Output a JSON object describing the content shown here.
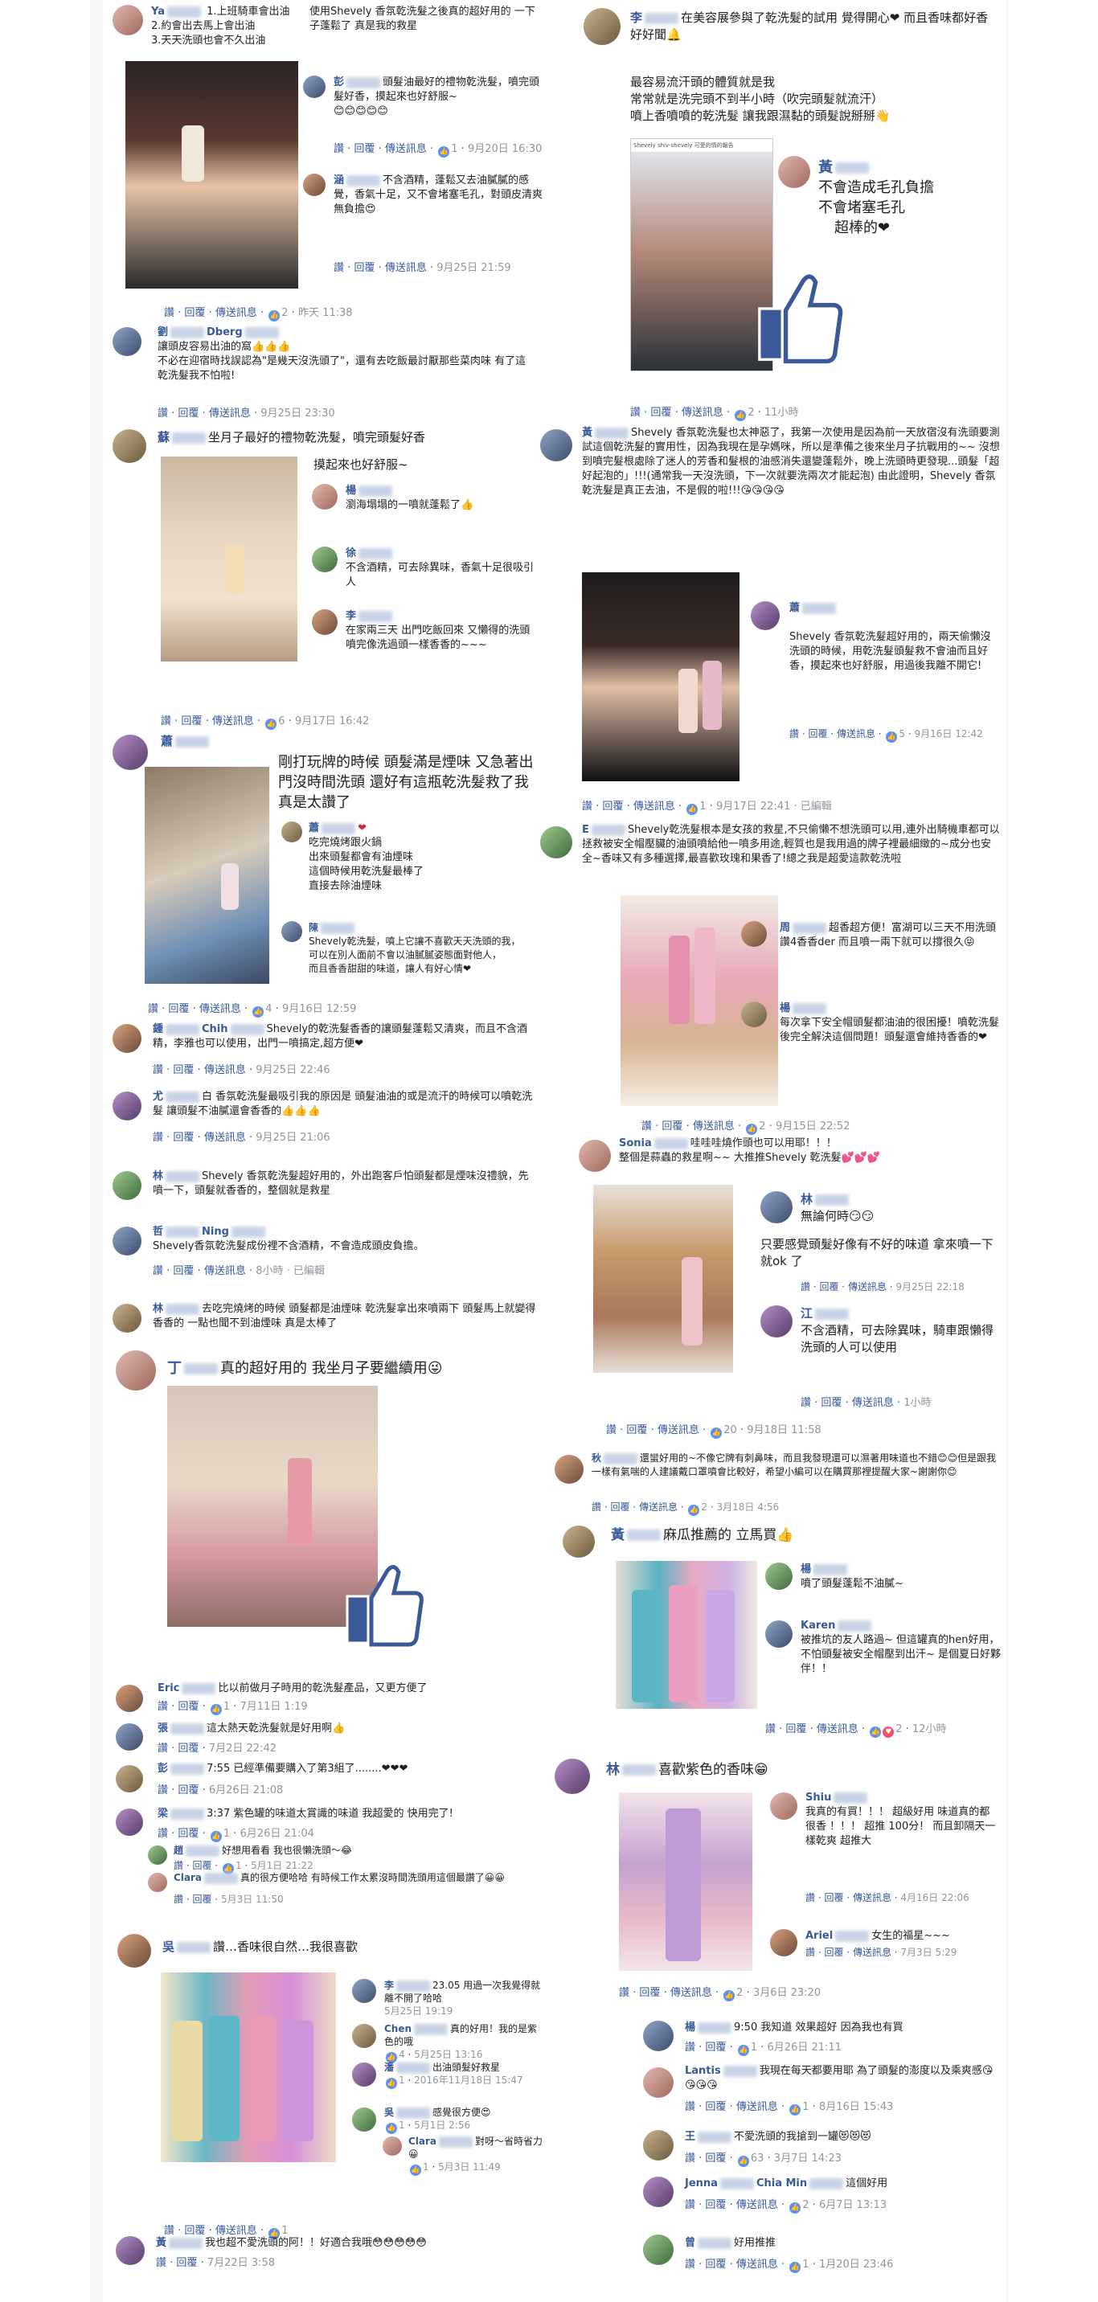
{
  "colors": {
    "link": "#385898",
    "muted": "#90949c",
    "background": "#f5f6f7",
    "like_blue": "#5890ff",
    "heart_red": "#e02434"
  },
  "actions": {
    "like": "讚",
    "reply": "回覆",
    "message": "傳送訊息"
  },
  "left": {
    "c1": {
      "name": "Ya",
      "lines": [
        "1.上班騎車會出油",
        "2.約會出去馬上會出油",
        "3.天天洗頭也會不久出油"
      ],
      "side": "使用Shevely 香氛乾洗髮之後真的超好用的 一下子蓬鬆了 真是我的救星",
      "reactions": "2",
      "time": "昨天 11:38",
      "r1": {
        "name": "彭",
        "text": "頭髮油最好的禮物乾洗髮，噴完頭髮好香，摸起來也好舒服~",
        "emoji": "😊😊😊😊😊",
        "reactions": "1",
        "time": "9月20日 16:30"
      },
      "r2": {
        "name": "涵",
        "text": "不含酒精，蓬鬆又去油膩膩的感覺，香氣十足，又不會堵塞毛孔，對頭皮清爽無負擔😍",
        "time": "9月25日 21:59"
      }
    },
    "c2": {
      "name": "劉",
      "name2": "Dberg",
      "text": "讓頭皮容易出油的窩👍👍👍",
      "text2": "不必在迎宿時找誤認為\"是幾天沒洗頭了\"，還有去吃飯最討厭那些菜肉味 有了這乾洗髮我不怕啦!",
      "time": "9月25日 23:30"
    },
    "c3": {
      "name": "蘇",
      "text": "坐月子最好的禮物乾洗髮，噴完頭髮好香",
      "text2": "摸起來也好舒服~",
      "reactions": "6",
      "time": "9月17日 16:42",
      "r1": {
        "name": "楊",
        "text": "瀏海塌塌的一噴就蓬鬆了👍"
      },
      "r2": {
        "name": "徐",
        "text": "不含酒精，可去除異味，香氣十足很吸引人"
      },
      "r3": {
        "name": "李",
        "text": "在家兩三天 出門吃飯回來 又懶得的洗頭 噴完像洗過頭一樣香香的~~~"
      }
    },
    "c4": {
      "name": "蕭",
      "text": "剛打玩牌的時候 頭髮滿是煙味 又急著出門沒時間洗頭 還好有這瓶乾洗髮救了我 真是太讚了",
      "reactions": "4",
      "time": "9月16日 12:59",
      "r1": {
        "name": "蕭",
        "lines": [
          "吃完燒烤跟火鍋",
          "出來頭髮都會有油煙味",
          "這個時候用乾洗髮最棒了",
          "直接去除油煙味"
        ]
      },
      "r2": {
        "name": "陳",
        "lines": [
          "Shevely乾洗髮，噴上它讓不喜歡天天洗頭的我，",
          "可以在別人面前不會以油膩膩姿態面對他人，",
          "而且香香甜甜的味道，讓人有好心情❤"
        ]
      }
    },
    "c5": {
      "name": "鍾",
      "name2": "Chih",
      "text": "Shevely的乾洗髮香香的讓頭髮蓬鬆又清爽，而且不含酒精，李雅也可以使用，出門一噴搞定,超方便❤",
      "time": "9月25日 22:46"
    },
    "c6": {
      "name": "尤",
      "text": "白 香氛乾洗髮最吸引我的原因是 頭髮油油的或是流汗的時候可以噴乾洗髮 讓頭髮不油膩還會香香的👍👍👍",
      "time": "9月25日 21:06"
    },
    "c7": {
      "name": "林",
      "text": "Shevely 香氛乾洗髮超好用的，外出跑客戶怕頭髮都是煙味沒禮貌，先噴一下，頭髮就香香的，整個就是救星"
    },
    "c8": {
      "name": "哲",
      "name2": "Ning",
      "text": "Shevely香氛乾洗髮成份裡不含酒精，不會造成頭皮負擔。",
      "time": "8小時 · 已編輯"
    },
    "c9": {
      "name": "林",
      "text": "去吃完燒烤的時候 頭髮都是油煙味 乾洗髮拿出來噴兩下 頭髮馬上就變得香香的 一點也聞不到油煙味 真是太棒了"
    },
    "c10": {
      "name": "丁",
      "text": "真的超好用的 我坐月子要繼續用😜",
      "replies": [
        {
          "name": "Eric",
          "text": "比以前做月子時用的乾洗髮產品，又更方便了",
          "reactions": "1",
          "time": "7月11日 1:19"
        },
        {
          "name": "張",
          "text": "這太熱天乾洗髮就是好用啊👍",
          "time": "7月2日 22:42"
        },
        {
          "name": "彭",
          "text": "7:55 已經準備要購入了第3組了........❤❤❤",
          "time": "6月26日 21:08"
        },
        {
          "name": "梁",
          "text": "3:37 紫色罐的味道太賞識的味道 我超愛的 快用完了!",
          "reactions": "1",
          "time": "6月26日 21:04"
        },
        {
          "name": "趙",
          "text": "好想用看看 我也很懶洗頭～😂",
          "reactions": "1",
          "time": "5月1日 21:22"
        },
        {
          "name": "Clara",
          "text": "真的很方便哈哈 有時候工作太累沒時間洗頭用這個最讚了😀😀",
          "time": "5月3日 11:50"
        }
      ]
    },
    "c11": {
      "name": "吳",
      "text": "讚…香味很自然…我很喜歡",
      "reactions": "1",
      "replies": [
        {
          "name": "李",
          "text": "23.05 用過一次我覺得就離不開了哈哈",
          "time": "5月25日 19:19"
        },
        {
          "name": "Chen",
          "text": "真的好用！我的是紫色的哦",
          "reactions": "4",
          "time": "5月25日 13:16"
        },
        {
          "name": "潘",
          "text": "出油頭髮好救星",
          "reactions": "1",
          "time": "2016年11月18日 15:47"
        },
        {
          "name": "吳",
          "text": "感覺很方便😍",
          "reactions": "1",
          "time": "5月1日 2:56"
        },
        {
          "name": "Clara",
          "text": "對呀～省時省力😀",
          "reactions": "1",
          "time": "5月3日 11:49"
        }
      ]
    },
    "c12": {
      "name": "黃",
      "text": "我也超不愛洗頭的阿！！好適合我哦😳😳😳😳😳",
      "time": "7月22日 3:58"
    }
  },
  "right": {
    "c1": {
      "name": "李",
      "text": "在美容展參與了乾洗髮的試用 覺得開心❤ 而且香味都好香好好聞🔔",
      "lines": [
        "最容易流汗頭的體質就是我",
        "常常就是洗完頭不到半小時（吹完頭髮就流汗）",
        "噴上香噴噴的乾洗髮 讓我跟濕黏的頭髮說掰掰👋"
      ],
      "reactions": "2",
      "time": "11小時",
      "phone_header": "Shevely shiv-shevely 可愛的情的報告",
      "r1": {
        "name": "黃",
        "lines": [
          "不會造成毛孔負擔",
          "不會堵塞毛孔",
          "超棒的❤"
        ]
      }
    },
    "c2": {
      "name": "黃",
      "text": "Shevely 香氛乾洗髮也太神惡了，我第一次使用是因為前一天放宿沒有洗頭要測試這個乾洗髮的實用性，因為我現在是孕媽咪，所以是準備之後來坐月子抗戰用的~~ 沒想到噴完髮根處除了迷人的芳香和髮根的油感消失還變蓬鬆外，晚上洗頭時更發現...頭髮「超好起泡的」!!!(通常我一天沒洗頭，下一次就要洗兩次才能起泡) 由此證明，Shevely 香氛乾洗髮是真正去油，不是假的啦!!!😘😘😘😘",
      "time": "9月17日 22:41 · 已編輯",
      "reactions": "1",
      "r1": {
        "name": "蕭",
        "text": "Shevely 香氛乾洗髮超好用的，兩天偷懶沒洗頭的時候，用乾洗髮頭髮救不會油而且好香，摸起來也好舒服，用過後我離不開它!",
        "reactions": "5",
        "time": "9月16日 12:42"
      }
    },
    "c3": {
      "name": "E",
      "text": "Shevely乾洗髮根本是女孩的救星,不只偷懶不想洗頭可以用,連外出騎機車都可以拯救被安全帽壓臟的油頭噴給他一噴多用途,輕質也是我用過的牌子裡最細緻的~成分也安全~香味又有多種選擇,最喜歡玫瑰和果香了!總之我是超愛這款乾洗啦",
      "reactions": "2",
      "time": "9月15日 22:52",
      "r1": {
        "name": "周",
        "text": "超香超方便！富湖可以三天不用洗頭讚4香香der 而且噴一兩下就可以撐很久😝"
      },
      "r2": {
        "name": "楊",
        "text": "每次拿下安全帽頭髮都油油的很困擾！噴乾洗髮後完全解決這個問題！頭髮還會維持香香的❤"
      }
    },
    "c4": {
      "name": "Sonia",
      "text": "哇哇哇燒作頭也可以用耶！！！",
      "text2": "整個是蒜蟲的救星啊~~ 大推推Shevely 乾洗髮💕💕💕",
      "reactions": "20",
      "time": "9月18日 11:58",
      "r1": {
        "name": "林",
        "text": "無論何時😏😏",
        "text2": "只要感覺頭髮好像有不好的味道 拿來噴一下就ok 了",
        "time": "9月25日 22:18"
      },
      "r2": {
        "name": "江",
        "text": "不含酒精，可去除異味，騎車跟懶得洗頭的人可以使用",
        "time": "1小時"
      }
    },
    "c5": {
      "name": "秋",
      "text": "還蠻好用的~不像它牌有刺鼻味，而且我發現還可以濕著用味道也不錯😊😊但是跟我一樣有氣喘的人建議戴口罩噴會比較好，希望小編可以在購買那裡提醒大家~謝謝你😊",
      "reactions": "2",
      "time": "3月18日 4:56"
    },
    "c6": {
      "name": "黃",
      "text": "麻瓜推薦的 立馬買👍",
      "reactions": "2",
      "time": "12小時",
      "r1": {
        "name": "楊",
        "text": "噴了頭髮蓬鬆不油膩~"
      },
      "r2": {
        "name": "Karen",
        "text": "被推坑的友人路過~ 但這罐真的hen好用， 不怕頭髮被安全帽壓到出汗~ 是個夏日好夥伴！！"
      }
    },
    "c7": {
      "name": "林",
      "text": "喜歡紫色的香味😁",
      "reactions": "2",
      "time": "3月6日 23:20",
      "r1": {
        "name": "Shiu",
        "text": "我真的有買！！！ 超級好用 味道真的都很香 ！！！ 超推 100分！ 而且卸隔天一樣乾爽 超推大",
        "time": "4月16日 22:06"
      },
      "r2": {
        "name": "Ariel",
        "text": "女生的福星~~~",
        "time": "7月3日 5:29"
      }
    },
    "replies": [
      {
        "name": "楊",
        "text": "9:50 我知道 效果超好 因為我也有買",
        "reactions": "1",
        "time": "6月26日 21:11"
      },
      {
        "name": "Lantis",
        "text": "我現在每天都要用耶 為了頭髮的澎度以及乘爽感😘😘😘😘",
        "reactions": "1",
        "time": "8月16日 15:43"
      },
      {
        "name": "王",
        "text": "不愛洗頭的我搶到一罐😻😻😻",
        "reactions": "63",
        "time": "3月7日 14:23"
      },
      {
        "name": "Jenna",
        "name2": "Chia Min",
        "text": "這個好用",
        "reactions": "2",
        "time": "6月7日 13:13"
      },
      {
        "name": "曾",
        "text": "好用推推",
        "reactions": "1",
        "time": "1月20日 23:46"
      }
    ]
  }
}
